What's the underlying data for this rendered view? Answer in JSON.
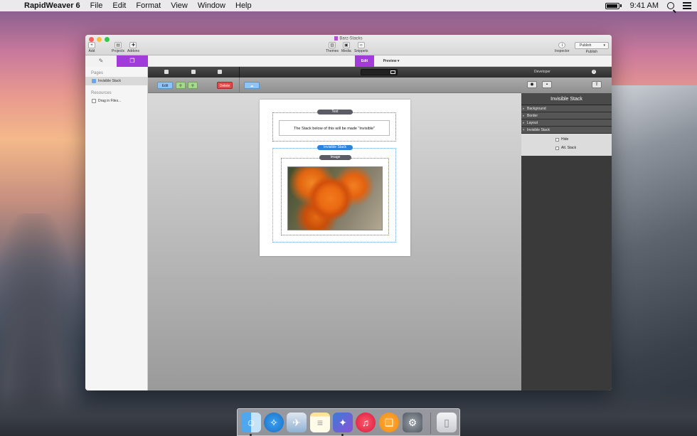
{
  "menubar": {
    "apple": "",
    "app_name": "RapidWeaver 6",
    "items": [
      "File",
      "Edit",
      "Format",
      "View",
      "Window",
      "Help"
    ],
    "clock": "9:41 AM"
  },
  "window": {
    "title": "Barz-Stacks",
    "toolbar": {
      "add": "Add",
      "projects": "Projects",
      "addons": "Addons",
      "themes": "Themes",
      "media": "Media",
      "snippets": "Snippets",
      "inspector": "Inspector",
      "publish_button": "Publish",
      "publish_label": "Publish"
    },
    "modes": {
      "edit": "Edit",
      "preview": "Preview"
    },
    "sidebar": {
      "pages_header": "Pages",
      "pages": [
        {
          "label": "Invisible Stack"
        }
      ],
      "resources_header": "Resources",
      "resources": [
        {
          "label": "Drag in Files..."
        }
      ]
    },
    "edit_toolbar": {
      "edit": "Edit",
      "delete": "Delete"
    },
    "canvas": {
      "text_stack_label": "Text",
      "text_content": "The Stack below of this will be made \"invisible\"",
      "invisible_stack_label": "Invisible Stack",
      "image_stack_label": "Image"
    },
    "inspector": {
      "header": "Developer",
      "title": "Invisible Stack",
      "sections": [
        "Background",
        "Border",
        "Layout",
        "Invisible Stack"
      ],
      "options": [
        {
          "label": "Hide",
          "checked": false
        },
        {
          "label": "Alt. Stack",
          "checked": false
        }
      ]
    }
  },
  "colors": {
    "accent_purple": "#a23bdc",
    "edit_blue": "#8ec5f5",
    "delete_red": "#e04a4a"
  },
  "dock": {
    "icons": [
      "finder-icon",
      "safari-icon",
      "mail-icon",
      "notes-icon",
      "rapidweaver-icon",
      "itunes-icon",
      "ibooks-icon",
      "system-preferences-icon",
      "trash-icon"
    ]
  }
}
